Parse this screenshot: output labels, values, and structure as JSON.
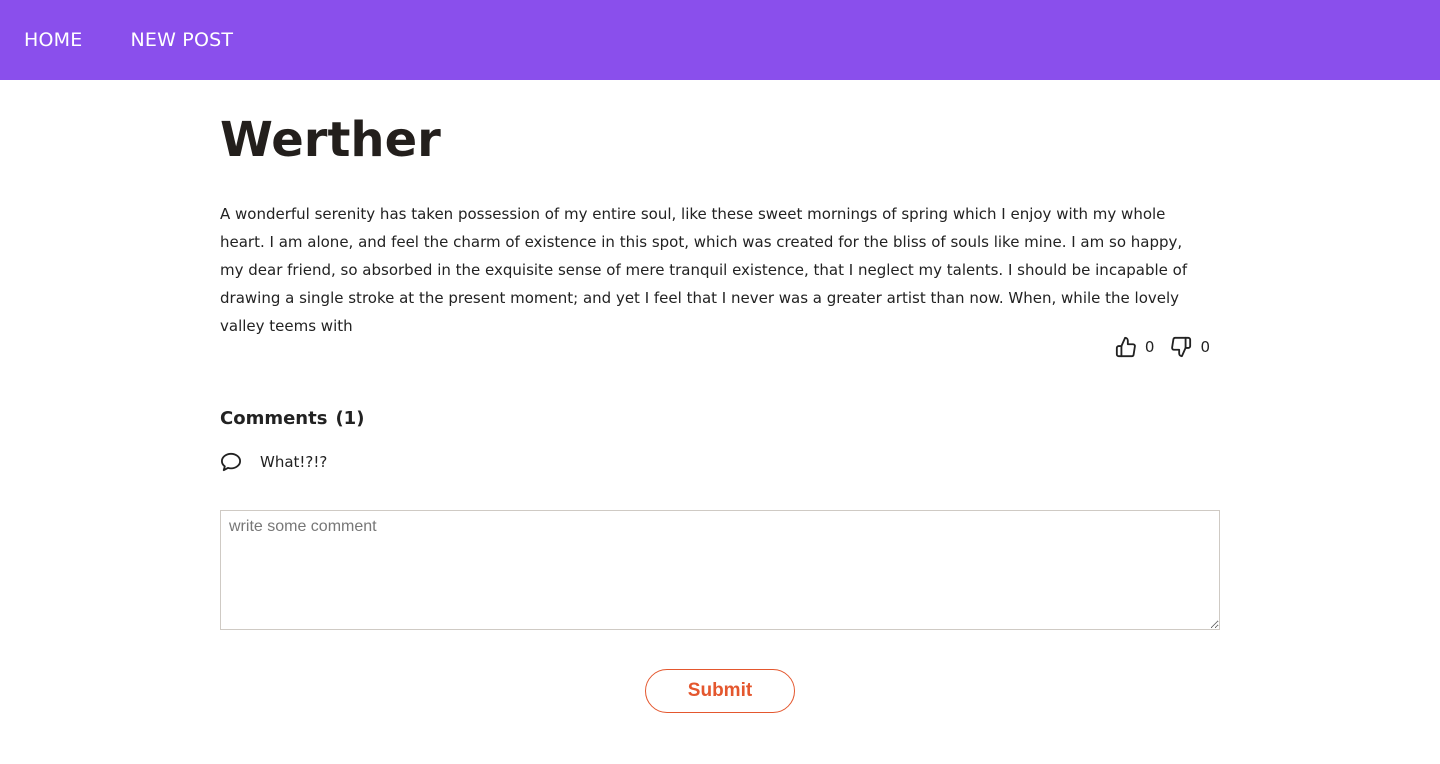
{
  "nav": {
    "home_label": "HOME",
    "new_post_label": "NEW POST"
  },
  "post": {
    "title": "Werther",
    "body": "A wonderful serenity has taken possession of my entire soul, like these sweet mornings of spring which I enjoy with my whole heart. I am alone, and feel the charm of existence in this spot, which was created for the bliss of souls like mine. I am so happy, my dear friend, so absorbed in the exquisite sense of mere tranquil existence, that I neglect my talents. I should be incapable of drawing a single stroke at the present moment; and yet I feel that I never was a greater artist than now. When, while the lovely valley teems with",
    "likes": "0",
    "dislikes": "0"
  },
  "comments": {
    "heading": "Comments",
    "count": "(1)",
    "items": [
      {
        "text": "What!?!?"
      }
    ],
    "input_placeholder": "write some comment",
    "submit_label": "Submit"
  },
  "colors": {
    "navbar": "#8a4fec",
    "accent": "#e4572e"
  },
  "icons": {
    "like": "thumbs-up-icon",
    "dislike": "thumbs-down-icon",
    "comment": "speech-bubble-icon"
  }
}
